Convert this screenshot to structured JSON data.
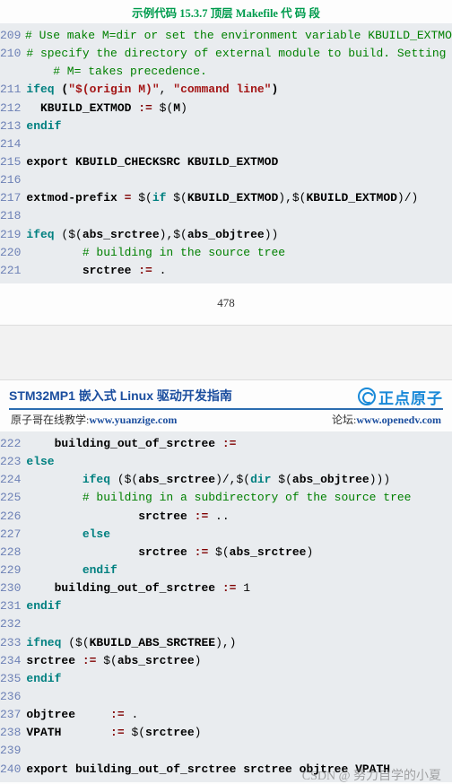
{
  "title": "示例代码 15.3.7  顶层 Makefile 代 码 段",
  "block1": [
    {
      "n": "209",
      "segs": [
        {
          "t": "# Use make M=dir or set the environment variable KBUILD_EXTMOD to",
          "cls": "c-green"
        }
      ]
    },
    {
      "n": "210",
      "segs": [
        {
          "t": "# specify the directory of external module to build. Setting",
          "cls": "c-green"
        }
      ]
    },
    {
      "n": "",
      "segs": [
        {
          "t": "    # M= takes precedence.",
          "cls": "c-green"
        }
      ]
    },
    {
      "n": "211",
      "segs": [
        {
          "t": "ifeq ",
          "cls": "c-teal b"
        },
        {
          "t": "(",
          "cls": "c-black b"
        },
        {
          "t": "\"$(origin M)\"",
          "cls": "c-red b"
        },
        {
          "t": ", ",
          "cls": "c-black"
        },
        {
          "t": "\"command line\"",
          "cls": "c-red b"
        },
        {
          "t": ")",
          "cls": "c-black b"
        }
      ]
    },
    {
      "n": "212",
      "segs": [
        {
          "t": "  KBUILD_EXTMOD ",
          "cls": "c-black b"
        },
        {
          "t": ":=",
          "cls": "c-dkred b"
        },
        {
          "t": " $(",
          "cls": "c-black"
        },
        {
          "t": "M",
          "cls": "c-black b"
        },
        {
          "t": ")",
          "cls": "c-black"
        }
      ]
    },
    {
      "n": "213",
      "segs": [
        {
          "t": "endif",
          "cls": "c-teal b"
        }
      ]
    },
    {
      "n": "214",
      "segs": [
        {
          "t": "",
          "cls": ""
        }
      ]
    },
    {
      "n": "215",
      "segs": [
        {
          "t": "export KBUILD_CHECKSRC KBUILD_EXTMOD",
          "cls": "c-black b"
        }
      ]
    },
    {
      "n": "216",
      "segs": [
        {
          "t": "",
          "cls": ""
        }
      ]
    },
    {
      "n": "217",
      "segs": [
        {
          "t": "extmod-prefix ",
          "cls": "c-black b"
        },
        {
          "t": "=",
          "cls": "c-dkred b"
        },
        {
          "t": " $(",
          "cls": "c-black"
        },
        {
          "t": "if ",
          "cls": "c-teal b"
        },
        {
          "t": "$(",
          "cls": "c-black"
        },
        {
          "t": "KBUILD_EXTMOD",
          "cls": "c-black b"
        },
        {
          "t": "),$(",
          "cls": "c-black"
        },
        {
          "t": "KBUILD_EXTMOD",
          "cls": "c-black b"
        },
        {
          "t": ")/)",
          "cls": "c-black"
        }
      ]
    },
    {
      "n": "218",
      "segs": [
        {
          "t": "",
          "cls": ""
        }
      ]
    },
    {
      "n": "219",
      "segs": [
        {
          "t": "ifeq ",
          "cls": "c-teal b"
        },
        {
          "t": "($(",
          "cls": "c-black"
        },
        {
          "t": "abs_srctree",
          "cls": "c-black b"
        },
        {
          "t": "),$(",
          "cls": "c-black"
        },
        {
          "t": "abs_objtree",
          "cls": "c-black b"
        },
        {
          "t": "))",
          "cls": "c-black"
        }
      ]
    },
    {
      "n": "220",
      "segs": [
        {
          "t": "        # building in the source tree",
          "cls": "c-green"
        }
      ]
    },
    {
      "n": "221",
      "segs": [
        {
          "t": "        srctree ",
          "cls": "c-black b"
        },
        {
          "t": ":=",
          "cls": "c-dkred b"
        },
        {
          "t": " .",
          "cls": "c-black"
        }
      ]
    }
  ],
  "pagenum": "478",
  "header": {
    "doctitle": "STM32MP1 嵌入式 Linux 驱动开发指南",
    "logo_text": "正点原子",
    "left_label": "原子哥在线教学:",
    "left_url": "www.yuanzige.com",
    "right_label": "论坛:",
    "right_url": "www.openedv.com"
  },
  "block2": [
    {
      "n": "222",
      "segs": [
        {
          "t": "    building_out_of_srctree ",
          "cls": "c-black b"
        },
        {
          "t": ":=",
          "cls": "c-dkred b"
        }
      ]
    },
    {
      "n": "223",
      "segs": [
        {
          "t": "else",
          "cls": "c-teal b"
        }
      ]
    },
    {
      "n": "224",
      "segs": [
        {
          "t": "        ifeq ",
          "cls": "c-teal b"
        },
        {
          "t": "($(",
          "cls": "c-black"
        },
        {
          "t": "abs_srctree",
          "cls": "c-black b"
        },
        {
          "t": ")/,$(",
          "cls": "c-black"
        },
        {
          "t": "dir ",
          "cls": "c-teal b"
        },
        {
          "t": "$(",
          "cls": "c-black"
        },
        {
          "t": "abs_objtree",
          "cls": "c-black b"
        },
        {
          "t": ")))",
          "cls": "c-black"
        }
      ]
    },
    {
      "n": "225",
      "segs": [
        {
          "t": "        # building in a subdirectory of the source tree",
          "cls": "c-green"
        }
      ]
    },
    {
      "n": "226",
      "segs": [
        {
          "t": "                srctree ",
          "cls": "c-black b"
        },
        {
          "t": ":=",
          "cls": "c-dkred b"
        },
        {
          "t": " ..",
          "cls": "c-black"
        }
      ]
    },
    {
      "n": "227",
      "segs": [
        {
          "t": "        else",
          "cls": "c-teal b"
        }
      ]
    },
    {
      "n": "228",
      "segs": [
        {
          "t": "                srctree ",
          "cls": "c-black b"
        },
        {
          "t": ":=",
          "cls": "c-dkred b"
        },
        {
          "t": " $(",
          "cls": "c-black"
        },
        {
          "t": "abs_srctree",
          "cls": "c-black b"
        },
        {
          "t": ")",
          "cls": "c-black"
        }
      ]
    },
    {
      "n": "229",
      "segs": [
        {
          "t": "        endif",
          "cls": "c-teal b"
        }
      ]
    },
    {
      "n": "230",
      "segs": [
        {
          "t": "    building_out_of_srctree ",
          "cls": "c-black b"
        },
        {
          "t": ":=",
          "cls": "c-dkred b"
        },
        {
          "t": " 1",
          "cls": "c-black"
        }
      ]
    },
    {
      "n": "231",
      "segs": [
        {
          "t": "endif",
          "cls": "c-teal b"
        }
      ]
    },
    {
      "n": "232",
      "segs": [
        {
          "t": "",
          "cls": ""
        }
      ]
    },
    {
      "n": "233",
      "segs": [
        {
          "t": "ifneq ",
          "cls": "c-teal b"
        },
        {
          "t": "($(",
          "cls": "c-black"
        },
        {
          "t": "KBUILD_ABS_SRCTREE",
          "cls": "c-black b"
        },
        {
          "t": "),)",
          "cls": "c-black"
        }
      ]
    },
    {
      "n": "234",
      "segs": [
        {
          "t": "srctree ",
          "cls": "c-black b"
        },
        {
          "t": ":=",
          "cls": "c-dkred b"
        },
        {
          "t": " $(",
          "cls": "c-black"
        },
        {
          "t": "abs_srctree",
          "cls": "c-black b"
        },
        {
          "t": ")",
          "cls": "c-black"
        }
      ]
    },
    {
      "n": "235",
      "segs": [
        {
          "t": "endif",
          "cls": "c-teal b"
        }
      ]
    },
    {
      "n": "236",
      "segs": [
        {
          "t": "",
          "cls": ""
        }
      ]
    },
    {
      "n": "237",
      "segs": [
        {
          "t": "objtree     ",
          "cls": "c-black b"
        },
        {
          "t": ":=",
          "cls": "c-dkred b"
        },
        {
          "t": " .",
          "cls": "c-black"
        }
      ]
    },
    {
      "n": "238",
      "segs": [
        {
          "t": "VPATH       ",
          "cls": "c-black b"
        },
        {
          "t": ":=",
          "cls": "c-dkred b"
        },
        {
          "t": " $(",
          "cls": "c-black"
        },
        {
          "t": "srctree",
          "cls": "c-black b"
        },
        {
          "t": ")",
          "cls": "c-black"
        }
      ]
    },
    {
      "n": "239",
      "segs": [
        {
          "t": "",
          "cls": ""
        }
      ]
    },
    {
      "n": "240",
      "segs": [
        {
          "t": "export building_out_of_srctree srctree objtree VPATH",
          "cls": "c-black b"
        }
      ]
    }
  ],
  "watermark": "CSDN @ 努力自学的小夏"
}
